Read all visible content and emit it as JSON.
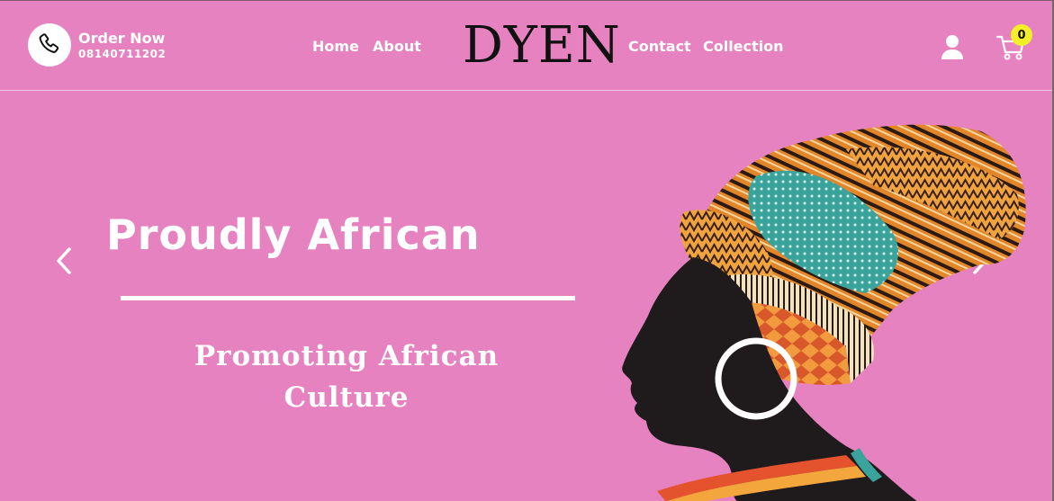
{
  "header": {
    "order_title": "Order Now",
    "order_phone": "08140711202",
    "nav": [
      "Home",
      "About",
      "Contact",
      "Collection"
    ],
    "logo": "DYEN",
    "cart_count": "0"
  },
  "hero": {
    "title": "Proudly African",
    "subtitle_line1": "Promoting African",
    "subtitle_line2": "Culture"
  },
  "colors": {
    "background": "#e782c0",
    "badge": "#f5ef2a",
    "text": "#ffffff"
  },
  "icons": [
    "phone-icon",
    "user-icon",
    "cart-icon",
    "chevron-left-icon",
    "chevron-right-icon"
  ]
}
